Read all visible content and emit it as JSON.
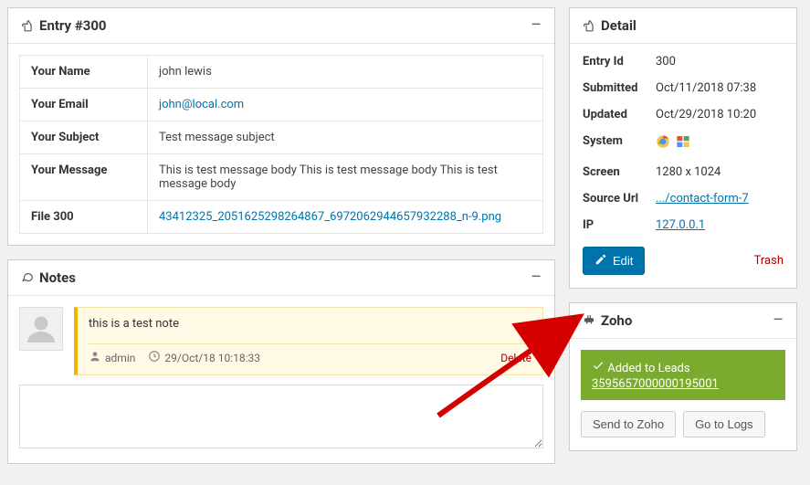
{
  "entry_panel": {
    "title": "Entry #300",
    "fields": [
      {
        "label": "Your Name",
        "value": "john lewis",
        "type": "text"
      },
      {
        "label": "Your Email",
        "value": "john@local.com",
        "type": "link"
      },
      {
        "label": "Your Subject",
        "value": "Test message subject",
        "type": "text"
      },
      {
        "label": "Your Message",
        "value": "This is test message body This is test message body This is test message body",
        "type": "text"
      },
      {
        "label": "File 300",
        "value": "43412325_2051625298264867_6972062944657932288_n-9.png",
        "type": "link"
      }
    ]
  },
  "notes_panel": {
    "title": "Notes",
    "items": [
      {
        "body": "this is a test note",
        "author": "admin",
        "time": "29/Oct/18 10:18:33"
      }
    ],
    "delete_label": "Delete"
  },
  "detail_panel": {
    "title": "Detail",
    "entry_id_label": "Entry Id",
    "entry_id": "300",
    "submitted_label": "Submitted",
    "submitted": "Oct/11/2018 07:38",
    "updated_label": "Updated",
    "updated": "Oct/29/2018 10:20",
    "system_label": "System",
    "screen_label": "Screen",
    "screen": "1280 x 1024",
    "source_url_label": "Source Url",
    "source_url": ".../contact-form-7",
    "ip_label": "IP",
    "ip": "127.0.0.1",
    "edit_label": "Edit",
    "trash_label": "Trash"
  },
  "zoho_panel": {
    "title": "Zoho",
    "status_text": "Added to Leads",
    "record_id": "3595657000000195001",
    "send_label": "Send to Zoho",
    "logs_label": "Go to Logs"
  },
  "icons": {
    "chrome": "chrome-icon",
    "windows": "windows-icon"
  }
}
